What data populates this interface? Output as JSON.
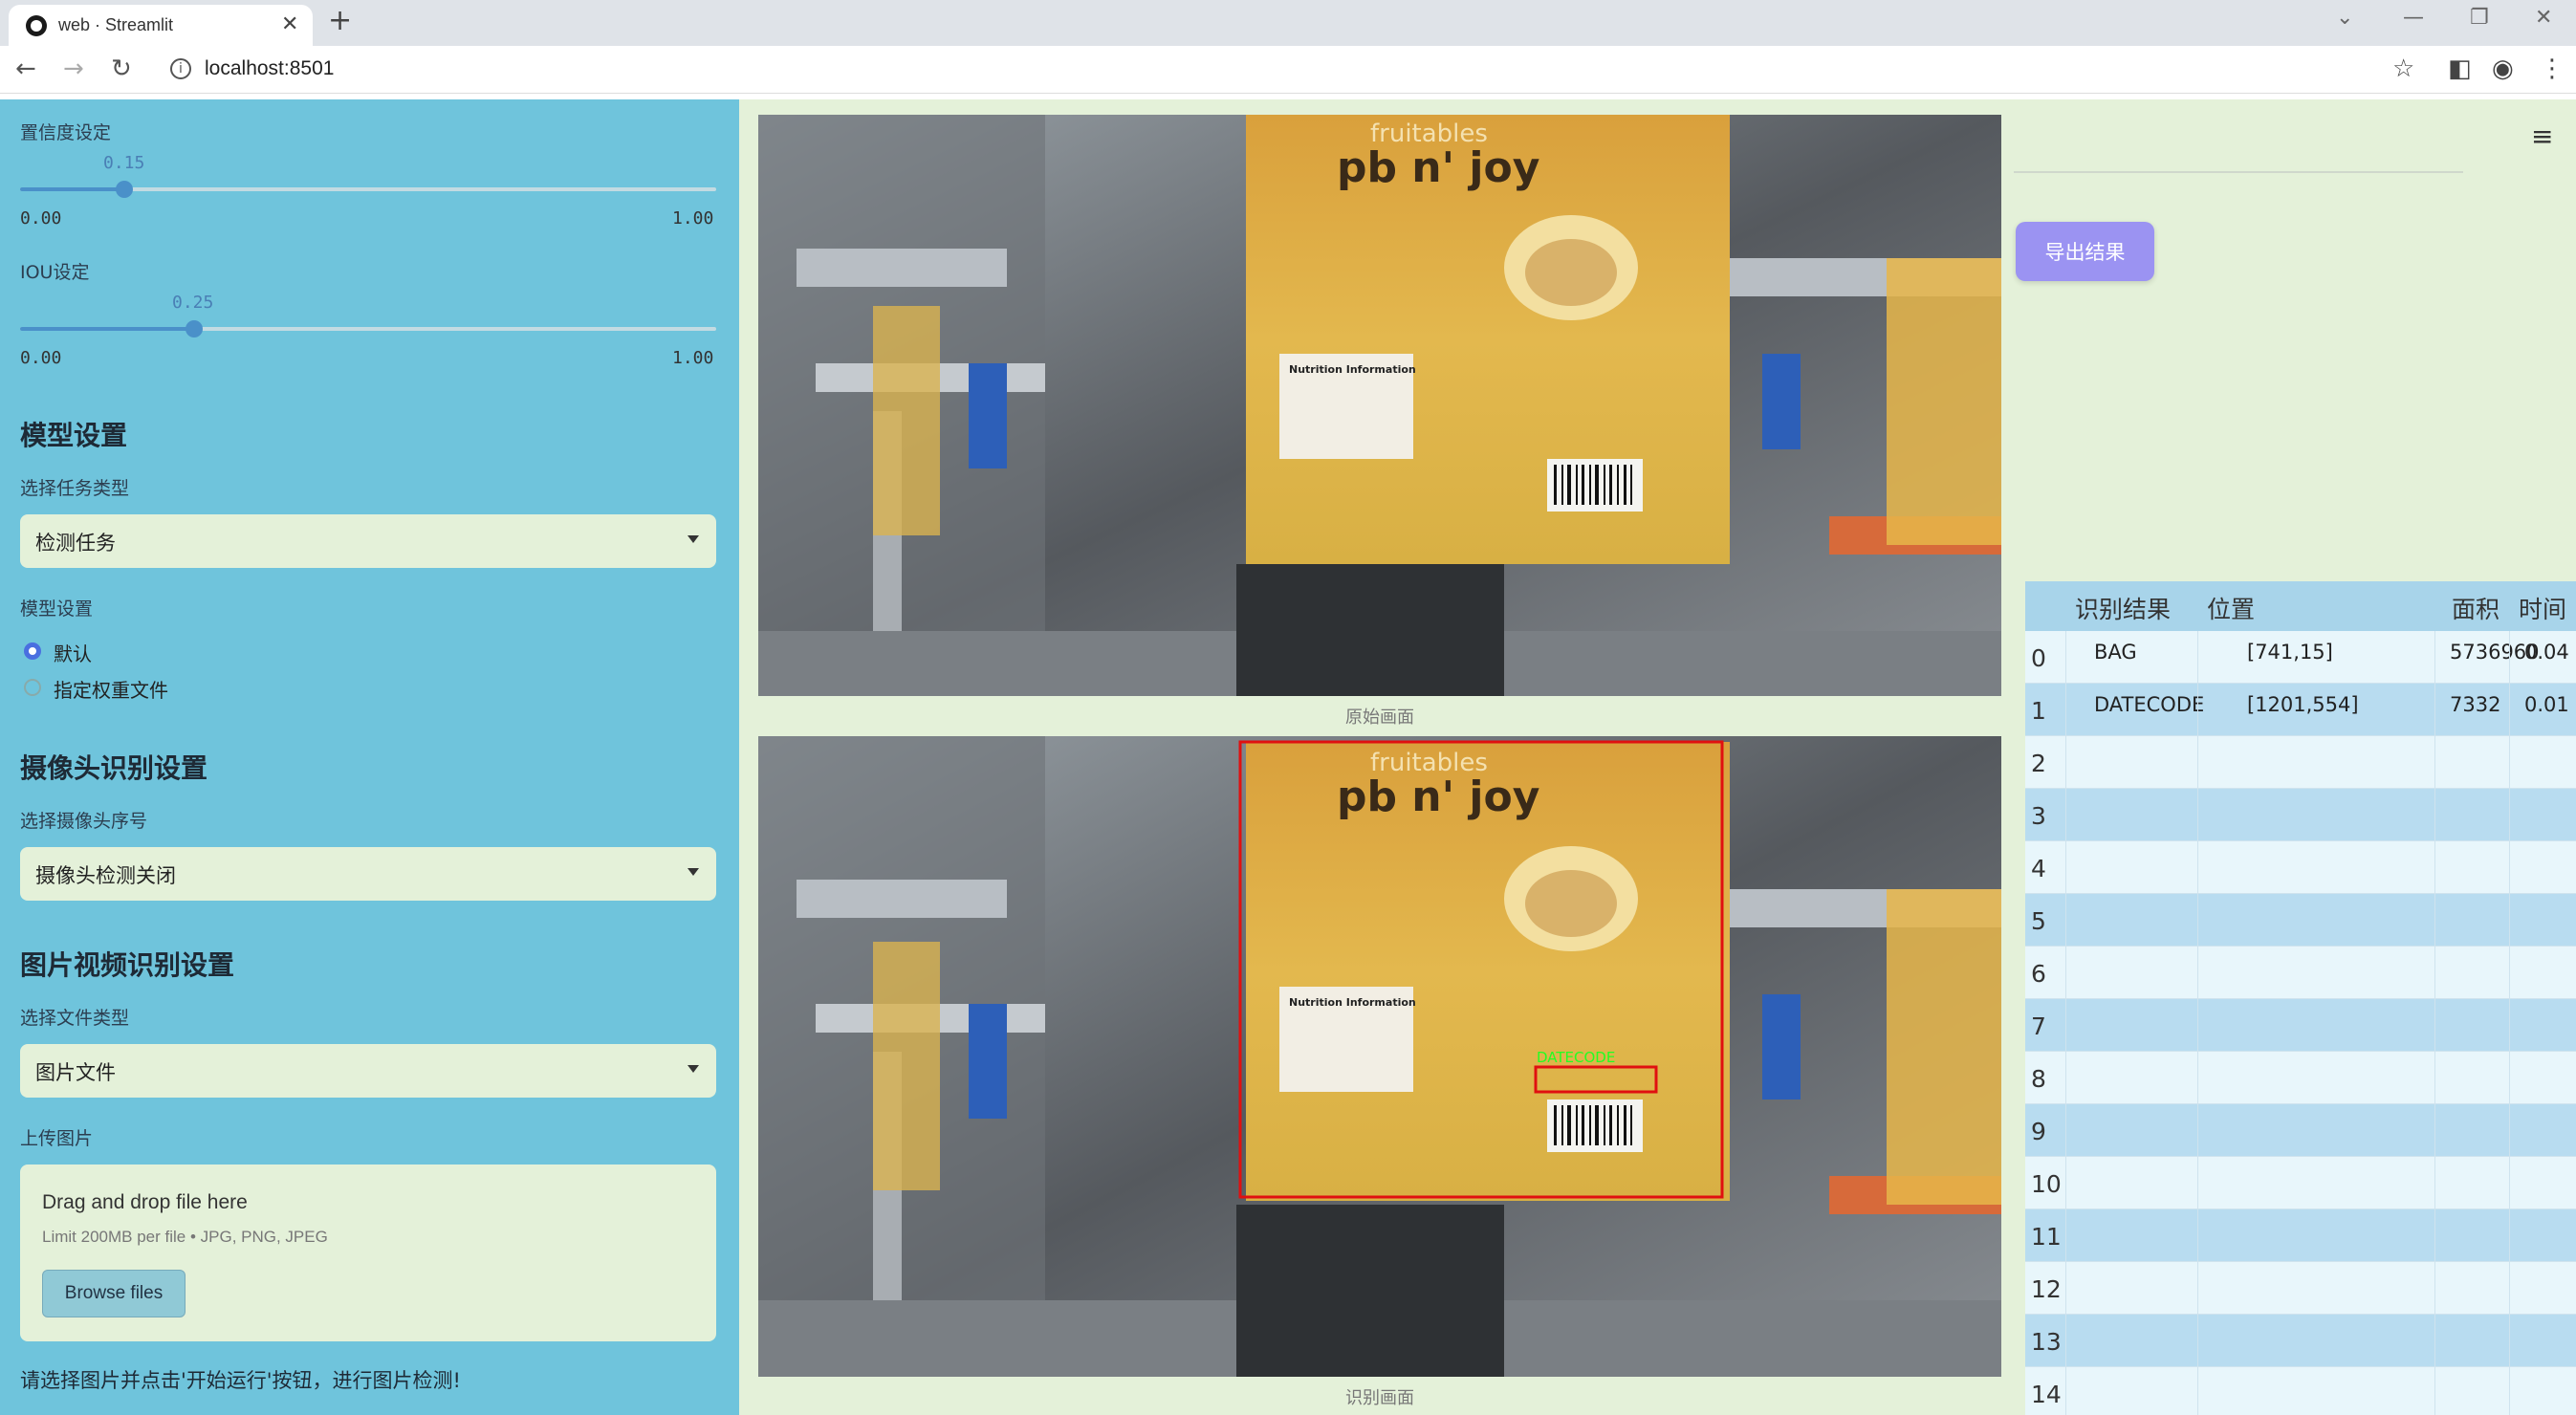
{
  "browser": {
    "tab_title": "web · Streamlit",
    "url": "localhost:8501"
  },
  "sidebar": {
    "confidence": {
      "label": "置信度设定",
      "value": "0.15",
      "fraction": 0.15,
      "min": "0.00",
      "max": "1.00"
    },
    "iou": {
      "label": "IOU设定",
      "value": "0.25",
      "fraction": 0.25,
      "min": "0.00",
      "max": "1.00"
    },
    "model_section": "模型设置",
    "task_type_label": "选择任务类型",
    "task_type_value": "检测任务",
    "model_setting_label": "模型设置",
    "radio_default": "默认",
    "radio_custom": "指定权重文件",
    "camera_section": "摄像头识别设置",
    "camera_index_label": "选择摄像头序号",
    "camera_index_value": "摄像头检测关闭",
    "media_section": "图片视频识别设置",
    "file_type_label": "选择文件类型",
    "file_type_value": "图片文件",
    "upload_label": "上传图片",
    "upload_title": "Drag and drop file here",
    "upload_limit": "Limit 200MB per file • JPG, PNG, JPEG",
    "browse_label": "Browse files",
    "hint": "请选择图片并点击'开始运行'按钮，进行图片检测!"
  },
  "main": {
    "original_caption": "原始画面",
    "result_caption": "识别画面",
    "detection_label": "DATECODE",
    "export_label": "导出结果",
    "package_brand": "pb n' joy",
    "package_top": "fruitables",
    "nutrition_title": "Nutrition Information"
  },
  "table": {
    "headers": [
      "识别结果",
      "位置",
      "面积",
      "时间"
    ],
    "rows": [
      {
        "index": "0",
        "result": "BAG",
        "position": "[741,15]",
        "area": "5736960",
        "time": "0.04"
      },
      {
        "index": "1",
        "result": "DATECODE",
        "position": "[1201,554]",
        "area": "7332",
        "time": "0.01"
      },
      {
        "index": "2"
      },
      {
        "index": "3"
      },
      {
        "index": "4"
      },
      {
        "index": "5"
      },
      {
        "index": "6"
      },
      {
        "index": "7"
      },
      {
        "index": "8"
      },
      {
        "index": "9"
      },
      {
        "index": "10"
      },
      {
        "index": "11"
      },
      {
        "index": "12"
      },
      {
        "index": "13"
      },
      {
        "index": "14"
      }
    ]
  },
  "colors": {
    "sidebar": "#6fc4dc",
    "main_bg": "#e4f1d9",
    "accent": "#4a90c9",
    "export": "#9b93f2",
    "detect_box": "#e01010",
    "detect_text": "#22ff22"
  }
}
